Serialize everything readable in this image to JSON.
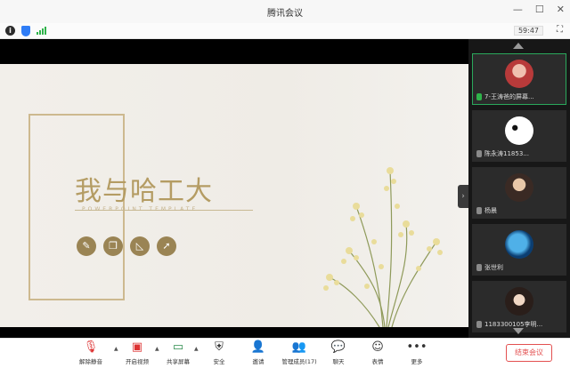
{
  "window": {
    "title": "腾讯会议"
  },
  "infobar": {
    "timer": "59:47"
  },
  "slide": {
    "title": "我与哈工大",
    "subtitle": "POWERPOINT TEMPLATE",
    "tool_icons": [
      "pen-icon",
      "book-icon",
      "ruler-icon",
      "cursor-icon"
    ]
  },
  "participants": [
    {
      "name": "7-王涛爸的屏幕...",
      "mic": "on",
      "active": true,
      "avatar": "avatar-red"
    },
    {
      "name": "陈永涛11853...",
      "mic": "off",
      "active": false,
      "avatar": "avatar-panda"
    },
    {
      "name": "杨晨",
      "mic": "off",
      "active": false,
      "avatar": "avatar-portrait"
    },
    {
      "name": "张世利",
      "mic": "off",
      "active": false,
      "avatar": "avatar-earth"
    },
    {
      "name": "1183300105李明...",
      "mic": "off",
      "active": false,
      "avatar": "avatar-girl"
    }
  ],
  "toolbar": {
    "unmute": "解除静音",
    "video": "开启视频",
    "share": "共享屏幕",
    "security": "安全",
    "invite": "邀请",
    "members": "管理成员(17)",
    "chat": "聊天",
    "expression": "表情",
    "more": "更多",
    "end": "结束会议"
  },
  "colors": {
    "accent": "#b49c63",
    "end": "#e35050",
    "active": "#2aa85b"
  }
}
